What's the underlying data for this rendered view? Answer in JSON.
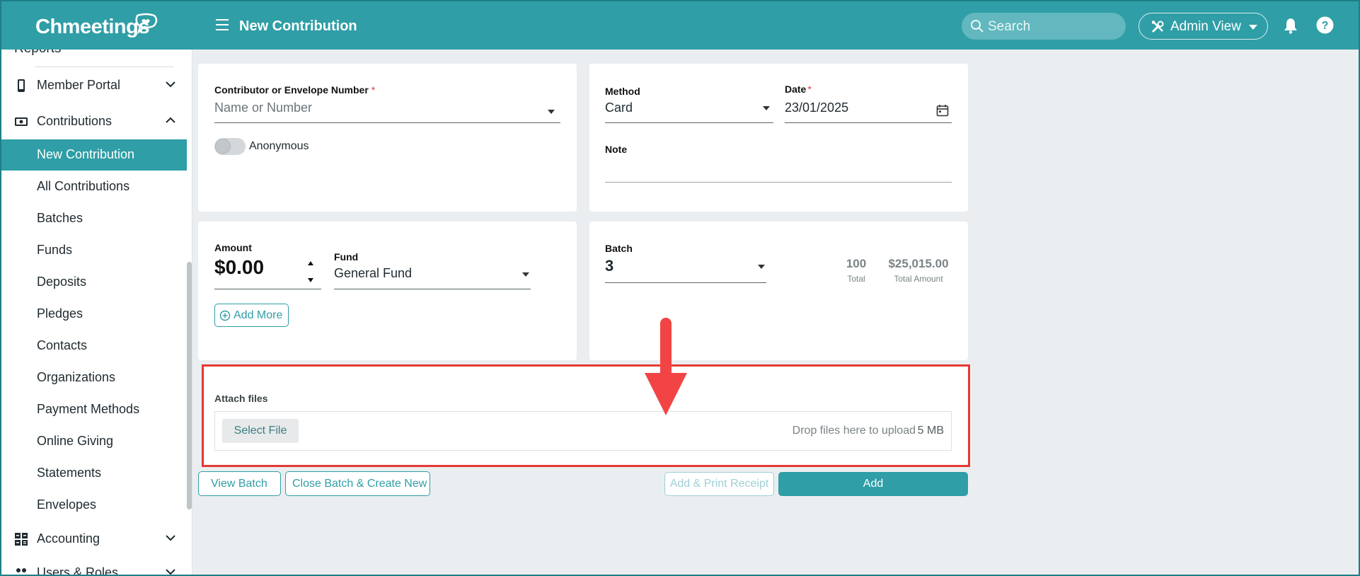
{
  "header": {
    "logo": "Chmeetings",
    "title": "New Contribution",
    "search_placeholder": "Search",
    "admin_view": "Admin View",
    "brand_color": "#2f9ea6"
  },
  "sidebar": {
    "cut_item": "Reports",
    "items": [
      {
        "label": "Member Portal",
        "icon": "phone-icon",
        "expanded": false
      },
      {
        "label": "Contributions",
        "icon": "cash-icon",
        "expanded": true
      },
      {
        "label": "Accounting",
        "icon": "calculator-icon",
        "expanded": false
      },
      {
        "label": "Users & Roles",
        "icon": "users-icon",
        "expanded": false
      }
    ],
    "contributions_sub": [
      "New Contribution",
      "All Contributions",
      "Batches",
      "Funds",
      "Deposits",
      "Pledges",
      "Contacts",
      "Organizations",
      "Payment Methods",
      "Online Giving",
      "Statements",
      "Envelopes"
    ],
    "active": "New Contribution"
  },
  "contributor": {
    "label": "Contributor or Envelope Number",
    "required_mark": "*",
    "placeholder": "Name or Number",
    "anonymous_label": "Anonymous"
  },
  "details": {
    "method_label": "Method",
    "method_value": "Card",
    "date_label": "Date",
    "date_required": "*",
    "date_value": "23/01/2025",
    "note_label": "Note"
  },
  "amount": {
    "label": "Amount",
    "value": "$0.00",
    "fund_label": "Fund",
    "fund_value": "General Fund",
    "add_more": "Add More"
  },
  "batch": {
    "label": "Batch",
    "value": "3",
    "total_count": "100",
    "total_count_label": "Total",
    "total_amount": "$25,015.00",
    "total_amount_label": "Total Amount"
  },
  "attach": {
    "label": "Attach files",
    "select_button": "Select File",
    "drop_text": "Drop files here to upload",
    "max_size": "5 MB"
  },
  "actions": {
    "view_batch": "View Batch",
    "close_batch": "Close Batch & Create New",
    "add_print": "Add & Print Receipt",
    "add": "Add"
  }
}
